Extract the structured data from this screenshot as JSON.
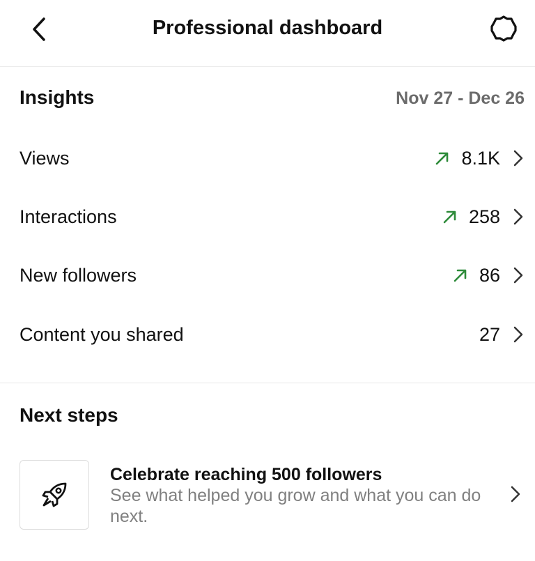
{
  "header": {
    "title": "Professional dashboard",
    "back_icon": "back-chevron-icon",
    "settings_icon": "gear-icon"
  },
  "insights": {
    "heading": "Insights",
    "date_range": "Nov 27 - Dec 26",
    "metrics": [
      {
        "label": "Views",
        "value": "8.1K",
        "trend": "up"
      },
      {
        "label": "Interactions",
        "value": "258",
        "trend": "up"
      },
      {
        "label": "New followers",
        "value": "86",
        "trend": "up"
      },
      {
        "label": "Content you shared",
        "value": "27",
        "trend": "none"
      }
    ]
  },
  "next_steps": {
    "heading": "Next steps",
    "card": {
      "icon": "rocket-icon",
      "title": "Celebrate reaching 500 followers",
      "description": "See what helped you grow and what you can do next."
    }
  },
  "colors": {
    "trend_up": "#2e8b3a",
    "muted_text": "#808080",
    "date_text": "#6b6b6b"
  }
}
